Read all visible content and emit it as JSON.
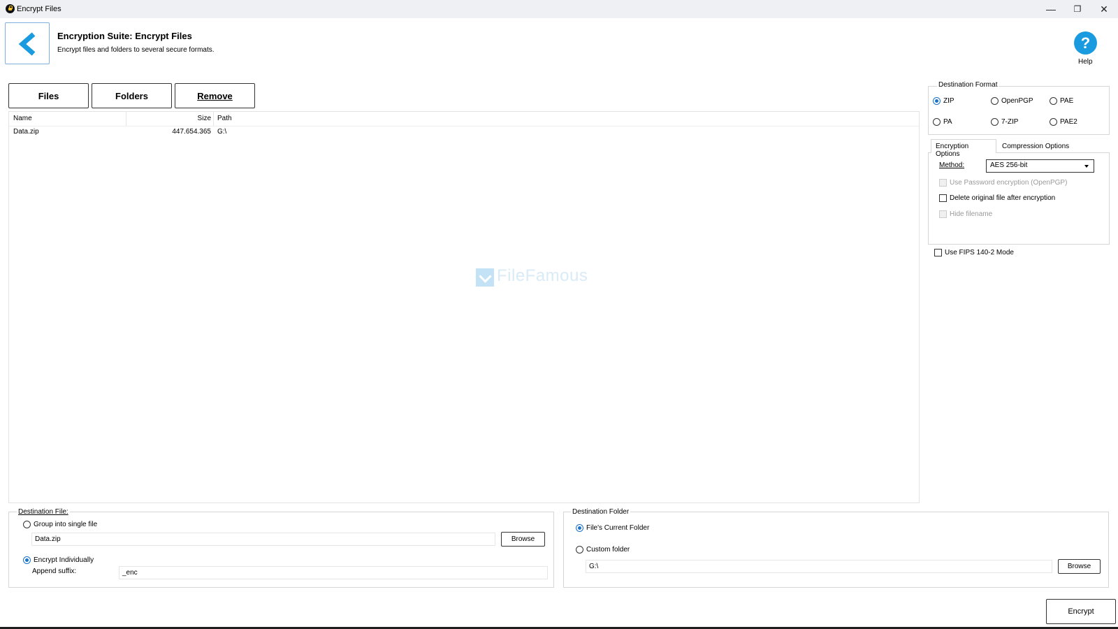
{
  "window": {
    "title": "Encrypt Files",
    "minimize": "—",
    "restore": "❐",
    "close": "✕"
  },
  "header": {
    "title": "Encryption Suite: Encrypt Files",
    "subtitle": "Encrypt files and folders to several secure formats.",
    "help_label": "Help",
    "help_glyph": "?"
  },
  "toolbar": {
    "files": "Files",
    "folders": "Folders",
    "remove": "Remove"
  },
  "file_list": {
    "columns": [
      "Name",
      "Size",
      "Path"
    ],
    "rows": [
      {
        "name": "Data.zip",
        "size": "447.654.365",
        "path": "G:\\"
      }
    ]
  },
  "watermark": "FileFamous",
  "destination_format": {
    "legend": "Destination Format",
    "options": [
      "ZIP",
      "OpenPGP",
      "PAE",
      "PA",
      "7-ZIP",
      "PAE2"
    ],
    "selected": "ZIP"
  },
  "tabs": {
    "encryption": "Encryption Options",
    "compression": "Compression Options"
  },
  "encryption_options": {
    "method_label": "Method:",
    "method_value": "AES 256-bit",
    "use_password": "Use Password encryption (OpenPGP)",
    "delete_original": "Delete original file after encryption",
    "hide_filename": "Hide filename"
  },
  "fips": "Use FIPS 140-2 Mode",
  "destination_file": {
    "legend": "Destination File:",
    "group_label": "Group into single file",
    "group_value": "Data.zip",
    "browse": "Browse",
    "individual_label": "Encrypt Individually",
    "suffix_label": "Append suffix:",
    "suffix_value": "_enc"
  },
  "destination_folder": {
    "legend": "Destination Folder",
    "current_label": "File's Current Folder",
    "custom_label": "Custom folder",
    "custom_value": "G:\\",
    "browse": "Browse"
  },
  "encrypt_button": "Encrypt",
  "colors": {
    "accent": "#1a9be0",
    "radio_selected": "#1a73c8"
  }
}
